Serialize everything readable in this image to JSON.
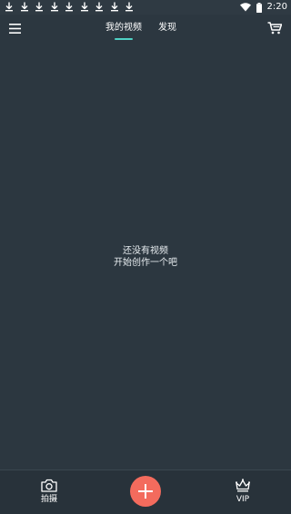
{
  "status_bar": {
    "time": "2:20",
    "download_icon_count": 9,
    "download_icons": [
      "download-icon",
      "download-icon",
      "download-icon",
      "download-icon",
      "download-icon",
      "download-icon",
      "download-icon",
      "download-icon",
      "download-icon"
    ],
    "right_icons": [
      "wifi-icon",
      "battery-icon"
    ]
  },
  "header": {
    "tabs": [
      {
        "label": "我的视频",
        "active": true
      },
      {
        "label": "发现",
        "active": false
      }
    ],
    "accent_color": "#4fd1c5",
    "icons": {
      "left": "menu-icon",
      "right": "cart-icon"
    }
  },
  "empty_state": {
    "line1": "还没有视频",
    "line2": "开始创作一个吧"
  },
  "bottom_nav": {
    "shoot_label": "拍摄",
    "vip_label": "VIP",
    "add_icon": "plus-icon",
    "add_button_color": "#f36b5d"
  },
  "colors": {
    "background": "#2c3740",
    "bottom_bar": "#28323a"
  }
}
